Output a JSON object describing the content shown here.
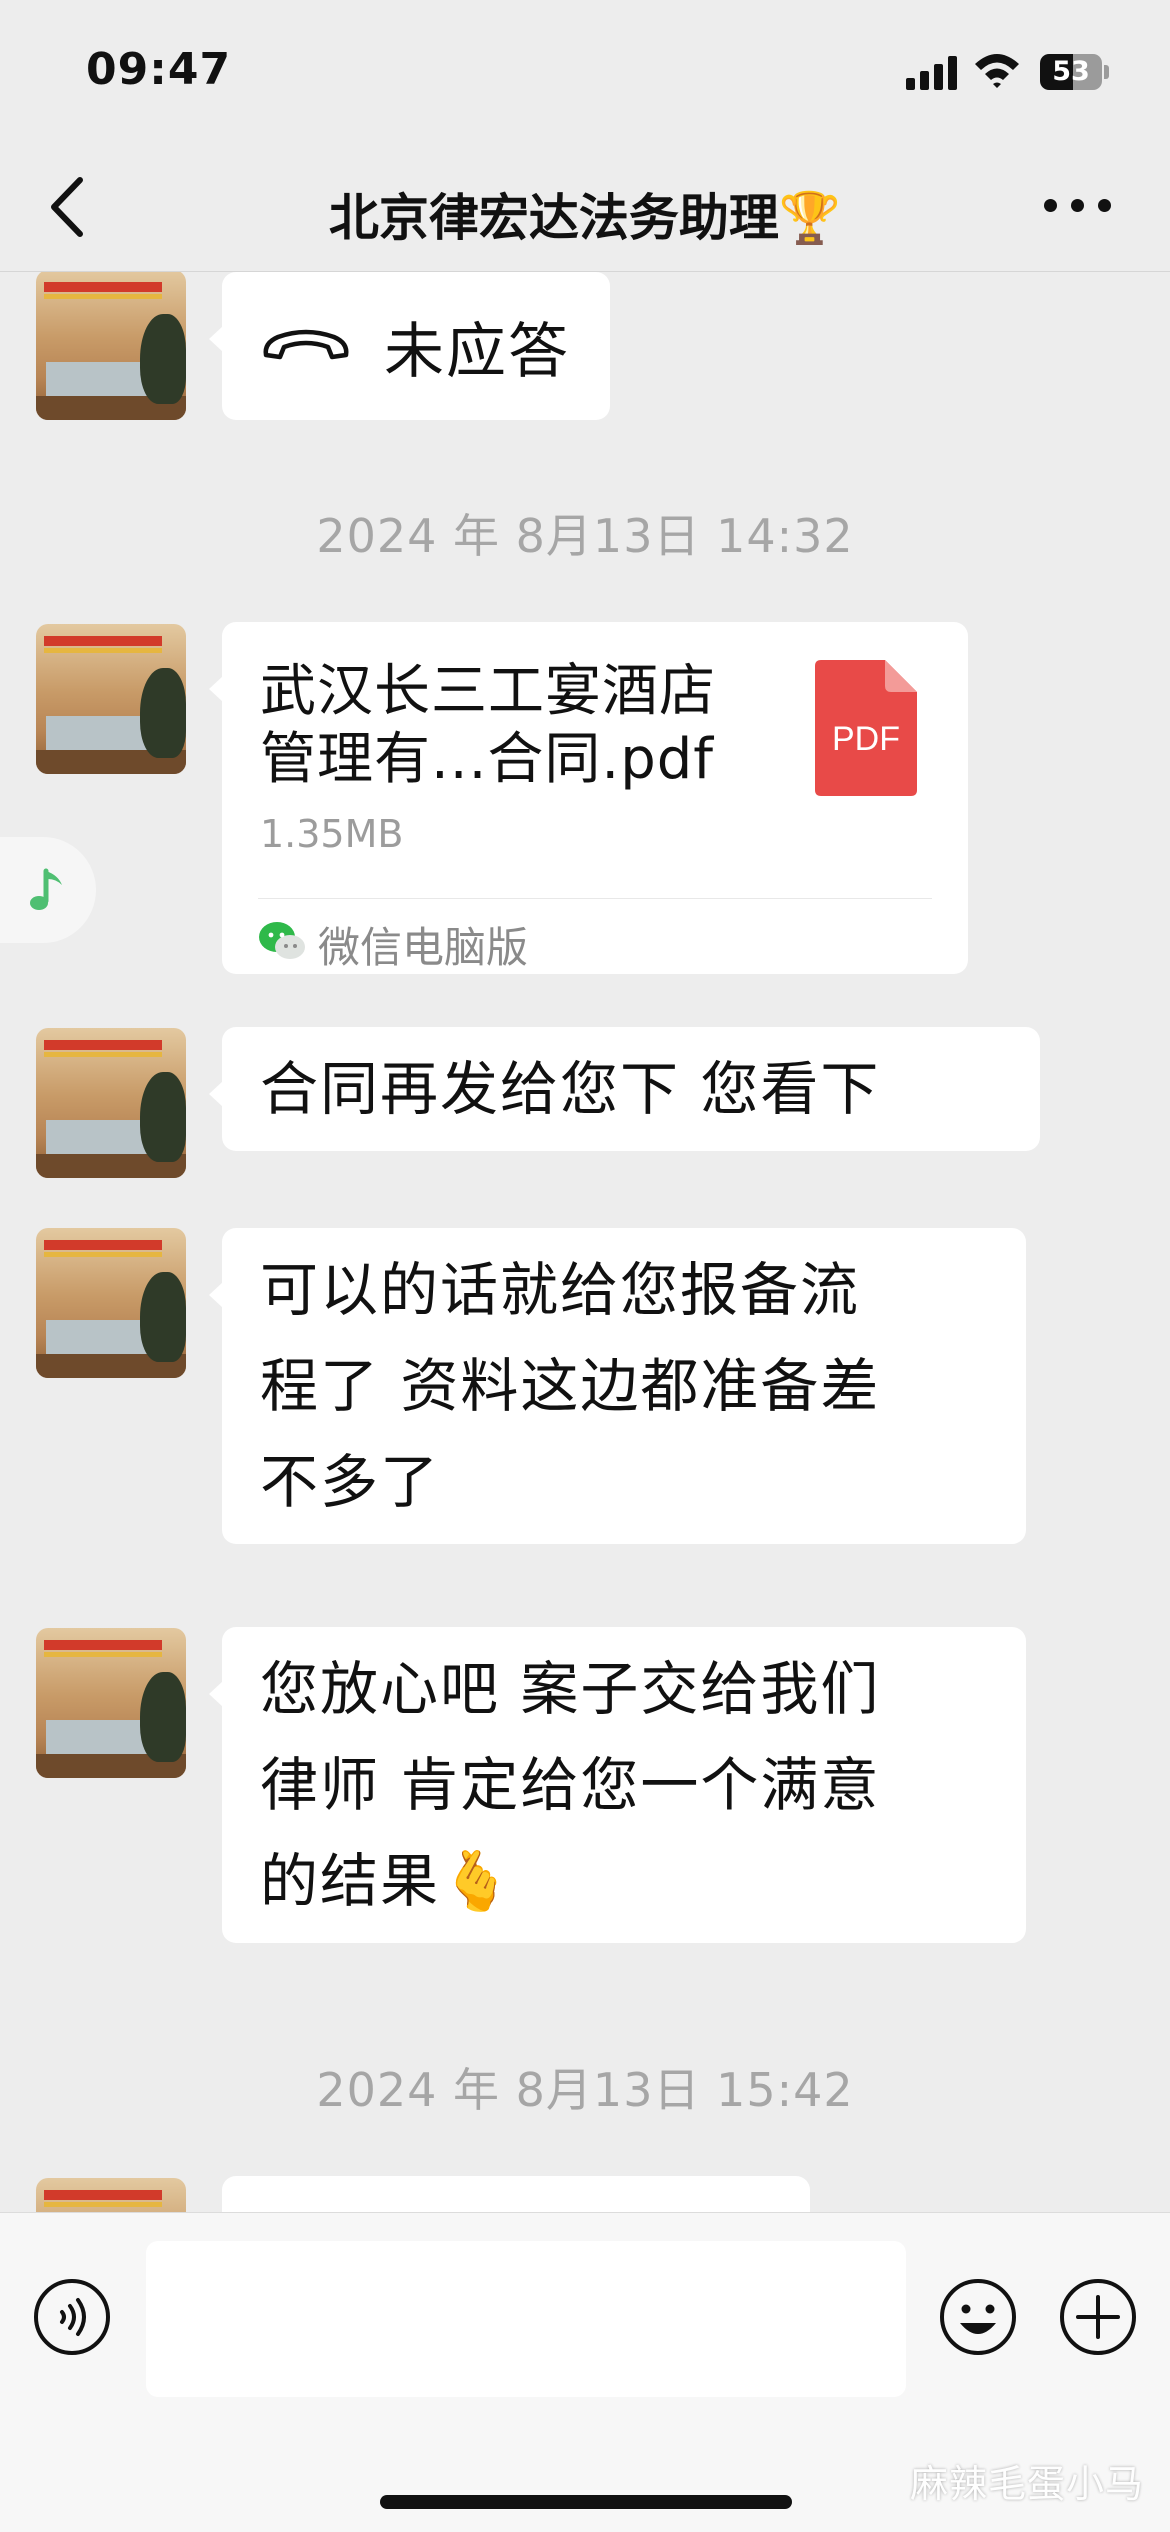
{
  "status_bar": {
    "time": "09:47",
    "battery_level": "53",
    "battery_fraction": 0.53
  },
  "header": {
    "title": "北京律宏达法务助理🏆",
    "back_icon": "chevron-left-icon",
    "more_icon": "ellipsis-icon"
  },
  "messages": [
    {
      "type": "call",
      "icon": "phone-hangup-icon",
      "text": "未应答"
    },
    {
      "type": "time",
      "text": "2024 年 8月13日 14:32"
    },
    {
      "type": "file",
      "name_line1": "武汉长三工宴酒店",
      "name_line2": "管理有...合同.pdf",
      "size": "1.35MB",
      "icon_label": "PDF",
      "source": "微信电脑版"
    },
    {
      "type": "text",
      "lines": [
        "合同再发给您下 您看下"
      ]
    },
    {
      "type": "text",
      "lines": [
        "可以的话就给您报备流",
        "程了 资料这边都准备差",
        "不多了"
      ]
    },
    {
      "type": "text",
      "lines": [
        "您放心吧 案子交给我们",
        "律师 肯定给您一个满意",
        "的结果🫰"
      ]
    },
    {
      "type": "time",
      "text": "2024 年 8月13日 15:42"
    }
  ],
  "floating": {
    "icon": "music-note-icon"
  },
  "input_bar": {
    "voice_icon": "voice-icon",
    "input_value": "",
    "emoji_icon": "smiley-icon",
    "plus_icon": "plus-circle-icon"
  },
  "watermark": "麻辣毛蛋小马",
  "colors": {
    "background": "#ededed",
    "bubble": "#ffffff",
    "pdf_red": "#e84a48",
    "wechat_green": "#2fb94a",
    "timestamp": "#a6a6a6"
  }
}
